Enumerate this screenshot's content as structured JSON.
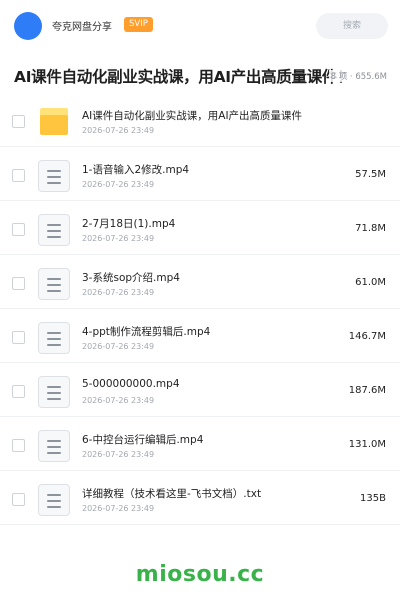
{
  "header": {
    "app_name": "夸克网盘分享",
    "badge": "SVIP",
    "search_label": "搜索"
  },
  "share": {
    "title": "AI课件自动化副业实战课，用AI产出高质量课件！",
    "meta": "8 项 · 655.6M"
  },
  "files": [
    {
      "name": "AI课件自动化副业实战课，用AI产出高质量课件",
      "date": "2026-07-26 23:49",
      "size": "",
      "type": "folder-icon"
    },
    {
      "name": "1-语音输入2修改.mp4",
      "date": "2026-07-26 23:49",
      "size": "57.5M",
      "type": "file-icon"
    },
    {
      "name": "2-7月18日(1).mp4",
      "date": "2026-07-26 23:49",
      "size": "71.8M",
      "type": "file-icon"
    },
    {
      "name": "3-系统sop介绍.mp4",
      "date": "2026-07-26 23:49",
      "size": "61.0M",
      "type": "file-icon"
    },
    {
      "name": "4-ppt制作流程剪辑后.mp4",
      "date": "2026-07-26 23:49",
      "size": "146.7M",
      "type": "file-icon"
    },
    {
      "name": "5-000000000.mp4",
      "date": "2026-07-26 23:49",
      "size": "187.6M",
      "type": "file-icon"
    },
    {
      "name": "6-中控台运行编辑后.mp4",
      "date": "2026-07-26 23:49",
      "size": "131.0M",
      "type": "file-icon"
    },
    {
      "name": "详细教程（技术看这里-飞书文档）.txt",
      "date": "2026-07-26 23:49",
      "size": "135B",
      "type": "file-icon"
    }
  ],
  "watermark": "miosou.cc",
  "colors": {
    "accent": "#2f7df6",
    "svip": "#ff9e2c",
    "folder": "#ffc53d",
    "watermark": "#3ab24a"
  }
}
